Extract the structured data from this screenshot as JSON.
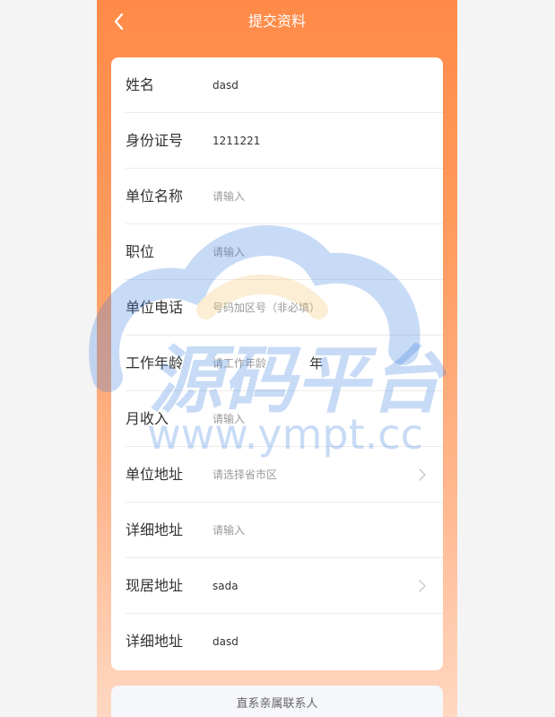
{
  "header": {
    "title": "提交资料"
  },
  "form": {
    "rows": [
      {
        "label": "姓名",
        "value": "dasd",
        "placeholder": ""
      },
      {
        "label": "身份证号",
        "value": "1211221",
        "placeholder": ""
      },
      {
        "label": "单位名称",
        "value": "",
        "placeholder": "请输入"
      },
      {
        "label": "职位",
        "value": "",
        "placeholder": "请输入"
      },
      {
        "label": "单位电话",
        "value": "",
        "placeholder": "号码加区号（非必填）"
      },
      {
        "label": "工作年龄",
        "value": "",
        "placeholder": "请工作年龄",
        "unit": "年"
      },
      {
        "label": "月收入",
        "value": "",
        "placeholder": "请输入"
      },
      {
        "label": "单位地址",
        "value": "请选择省市区"
      },
      {
        "label": "详细地址",
        "value": "",
        "placeholder": "请输入"
      },
      {
        "label": "现居地址",
        "value": "sada"
      },
      {
        "label": "详细地址",
        "value": "dasd",
        "placeholder": ""
      }
    ]
  },
  "section": {
    "title": "直系亲属联系人"
  },
  "watermark": {
    "title": "源码平台",
    "url": "www.ympt.cc"
  },
  "colors": {
    "header_gradient_top": "#ff8a47",
    "header_gradient_bottom": "#ffd8c2",
    "card_bg": "#ffffff",
    "placeholder": "#999999",
    "text": "#333333",
    "watermark_blue": "#3d7fe0",
    "watermark_gold": "#f4c36a"
  },
  "icons": {
    "back": "chevron-left-icon",
    "arrow": "chevron-right-icon"
  }
}
